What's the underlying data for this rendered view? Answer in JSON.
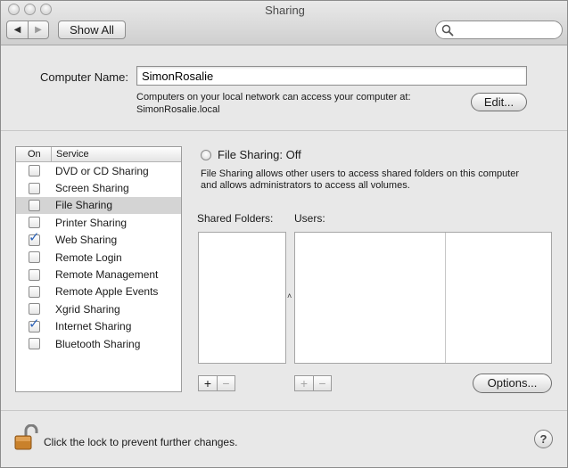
{
  "window": {
    "title": "Sharing",
    "toolbar": {
      "back": "◀",
      "forward": "▶",
      "show_all": "Show All",
      "search_placeholder": ""
    }
  },
  "computer_name": {
    "label": "Computer Name:",
    "value": "SimonRosalie",
    "desc_line1": "Computers on your local network can access your computer at:",
    "desc_line2": "SimonRosalie.local",
    "edit_label": "Edit..."
  },
  "services": {
    "col_on": "On",
    "col_service": "Service",
    "items": [
      {
        "name": "DVD or CD Sharing",
        "on": false,
        "selected": false
      },
      {
        "name": "Screen Sharing",
        "on": false,
        "selected": false
      },
      {
        "name": "File Sharing",
        "on": false,
        "selected": true
      },
      {
        "name": "Printer Sharing",
        "on": false,
        "selected": false
      },
      {
        "name": "Web Sharing",
        "on": true,
        "selected": false
      },
      {
        "name": "Remote Login",
        "on": false,
        "selected": false
      },
      {
        "name": "Remote Management",
        "on": false,
        "selected": false
      },
      {
        "name": "Remote Apple Events",
        "on": false,
        "selected": false
      },
      {
        "name": "Xgrid Sharing",
        "on": false,
        "selected": false
      },
      {
        "name": "Internet Sharing",
        "on": true,
        "selected": false
      },
      {
        "name": "Bluetooth Sharing",
        "on": false,
        "selected": false
      }
    ]
  },
  "detail": {
    "status": "File Sharing: Off",
    "desc_line1": "File Sharing allows other users to access shared folders on this computer",
    "desc_line2": "and allows administrators to access all volumes.",
    "shared_folders_label": "Shared Folders:",
    "users_label": "Users:",
    "plus": "+",
    "minus": "−",
    "caret": "˄",
    "options_label": "Options..."
  },
  "footer": {
    "lock_text": "Click the lock to prevent further changes.",
    "help": "?"
  },
  "colors": {
    "accent": "#2d63b8",
    "selection": "#d4d4d4"
  }
}
